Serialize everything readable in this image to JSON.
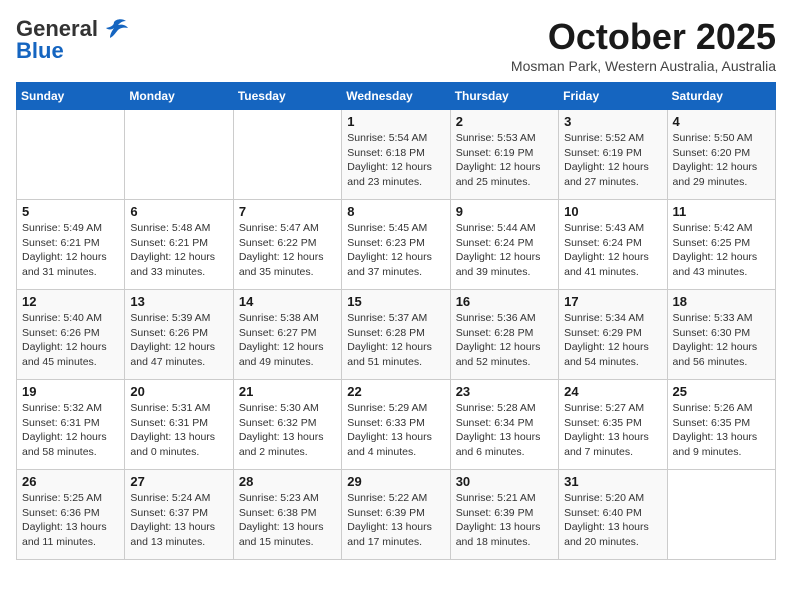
{
  "header": {
    "logo_general": "General",
    "logo_blue": "Blue",
    "title": "October 2025",
    "subtitle": "Mosman Park, Western Australia, Australia"
  },
  "weekdays": [
    "Sunday",
    "Monday",
    "Tuesday",
    "Wednesday",
    "Thursday",
    "Friday",
    "Saturday"
  ],
  "weeks": [
    [
      {
        "day": "",
        "info": ""
      },
      {
        "day": "",
        "info": ""
      },
      {
        "day": "",
        "info": ""
      },
      {
        "day": "1",
        "info": "Sunrise: 5:54 AM\nSunset: 6:18 PM\nDaylight: 12 hours and 23 minutes."
      },
      {
        "day": "2",
        "info": "Sunrise: 5:53 AM\nSunset: 6:19 PM\nDaylight: 12 hours and 25 minutes."
      },
      {
        "day": "3",
        "info": "Sunrise: 5:52 AM\nSunset: 6:19 PM\nDaylight: 12 hours and 27 minutes."
      },
      {
        "day": "4",
        "info": "Sunrise: 5:50 AM\nSunset: 6:20 PM\nDaylight: 12 hours and 29 minutes."
      }
    ],
    [
      {
        "day": "5",
        "info": "Sunrise: 5:49 AM\nSunset: 6:21 PM\nDaylight: 12 hours and 31 minutes."
      },
      {
        "day": "6",
        "info": "Sunrise: 5:48 AM\nSunset: 6:21 PM\nDaylight: 12 hours and 33 minutes."
      },
      {
        "day": "7",
        "info": "Sunrise: 5:47 AM\nSunset: 6:22 PM\nDaylight: 12 hours and 35 minutes."
      },
      {
        "day": "8",
        "info": "Sunrise: 5:45 AM\nSunset: 6:23 PM\nDaylight: 12 hours and 37 minutes."
      },
      {
        "day": "9",
        "info": "Sunrise: 5:44 AM\nSunset: 6:24 PM\nDaylight: 12 hours and 39 minutes."
      },
      {
        "day": "10",
        "info": "Sunrise: 5:43 AM\nSunset: 6:24 PM\nDaylight: 12 hours and 41 minutes."
      },
      {
        "day": "11",
        "info": "Sunrise: 5:42 AM\nSunset: 6:25 PM\nDaylight: 12 hours and 43 minutes."
      }
    ],
    [
      {
        "day": "12",
        "info": "Sunrise: 5:40 AM\nSunset: 6:26 PM\nDaylight: 12 hours and 45 minutes."
      },
      {
        "day": "13",
        "info": "Sunrise: 5:39 AM\nSunset: 6:26 PM\nDaylight: 12 hours and 47 minutes."
      },
      {
        "day": "14",
        "info": "Sunrise: 5:38 AM\nSunset: 6:27 PM\nDaylight: 12 hours and 49 minutes."
      },
      {
        "day": "15",
        "info": "Sunrise: 5:37 AM\nSunset: 6:28 PM\nDaylight: 12 hours and 51 minutes."
      },
      {
        "day": "16",
        "info": "Sunrise: 5:36 AM\nSunset: 6:28 PM\nDaylight: 12 hours and 52 minutes."
      },
      {
        "day": "17",
        "info": "Sunrise: 5:34 AM\nSunset: 6:29 PM\nDaylight: 12 hours and 54 minutes."
      },
      {
        "day": "18",
        "info": "Sunrise: 5:33 AM\nSunset: 6:30 PM\nDaylight: 12 hours and 56 minutes."
      }
    ],
    [
      {
        "day": "19",
        "info": "Sunrise: 5:32 AM\nSunset: 6:31 PM\nDaylight: 12 hours and 58 minutes."
      },
      {
        "day": "20",
        "info": "Sunrise: 5:31 AM\nSunset: 6:31 PM\nDaylight: 13 hours and 0 minutes."
      },
      {
        "day": "21",
        "info": "Sunrise: 5:30 AM\nSunset: 6:32 PM\nDaylight: 13 hours and 2 minutes."
      },
      {
        "day": "22",
        "info": "Sunrise: 5:29 AM\nSunset: 6:33 PM\nDaylight: 13 hours and 4 minutes."
      },
      {
        "day": "23",
        "info": "Sunrise: 5:28 AM\nSunset: 6:34 PM\nDaylight: 13 hours and 6 minutes."
      },
      {
        "day": "24",
        "info": "Sunrise: 5:27 AM\nSunset: 6:35 PM\nDaylight: 13 hours and 7 minutes."
      },
      {
        "day": "25",
        "info": "Sunrise: 5:26 AM\nSunset: 6:35 PM\nDaylight: 13 hours and 9 minutes."
      }
    ],
    [
      {
        "day": "26",
        "info": "Sunrise: 5:25 AM\nSunset: 6:36 PM\nDaylight: 13 hours and 11 minutes."
      },
      {
        "day": "27",
        "info": "Sunrise: 5:24 AM\nSunset: 6:37 PM\nDaylight: 13 hours and 13 minutes."
      },
      {
        "day": "28",
        "info": "Sunrise: 5:23 AM\nSunset: 6:38 PM\nDaylight: 13 hours and 15 minutes."
      },
      {
        "day": "29",
        "info": "Sunrise: 5:22 AM\nSunset: 6:39 PM\nDaylight: 13 hours and 17 minutes."
      },
      {
        "day": "30",
        "info": "Sunrise: 5:21 AM\nSunset: 6:39 PM\nDaylight: 13 hours and 18 minutes."
      },
      {
        "day": "31",
        "info": "Sunrise: 5:20 AM\nSunset: 6:40 PM\nDaylight: 13 hours and 20 minutes."
      },
      {
        "day": "",
        "info": ""
      }
    ]
  ]
}
